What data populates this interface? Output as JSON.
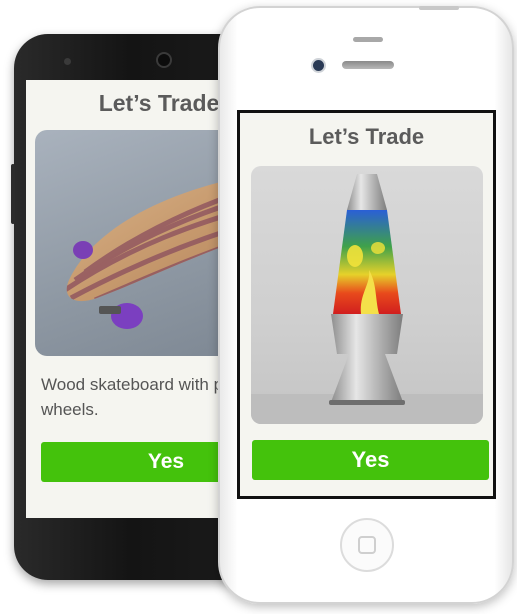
{
  "android_app": {
    "title": "Let’s Trade",
    "item_image": "skateboard-photo",
    "description": "Wood skateboard with purple wheels.",
    "yes_label": "Yes"
  },
  "iphone_app": {
    "title": "Let’s Trade",
    "item_image": "lava-lamp-photo",
    "yes_label": "Yes"
  },
  "colors": {
    "accent_green": "#44c20c",
    "screen_background": "#f5f5f0",
    "title_gray": "#5b5b5b"
  }
}
